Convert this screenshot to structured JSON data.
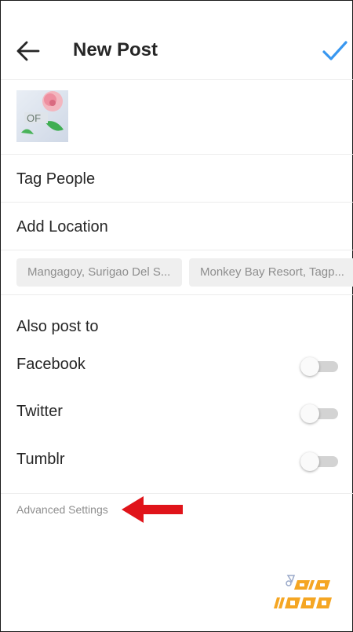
{
  "header": {
    "title": "New Post",
    "back_icon": "arrow-left-icon",
    "confirm_icon": "checkmark-icon",
    "accent_color": "#3897f0"
  },
  "post": {
    "thumbnail_alt": "rose-photo",
    "caption_value": "",
    "caption_placeholder": ""
  },
  "options": {
    "tag_people": "Tag People",
    "add_location": "Add Location"
  },
  "location_suggestions": [
    "Mangagoy, Surigao Del S...",
    "Monkey Bay Resort, Tagp..."
  ],
  "share": {
    "section_title": "Also post to",
    "targets": [
      {
        "label": "Facebook",
        "enabled": false
      },
      {
        "label": "Twitter",
        "enabled": false
      },
      {
        "label": "Tumblr",
        "enabled": false
      }
    ]
  },
  "advanced_settings": "Advanced Settings",
  "annotation": {
    "arrow_color": "#e0141a"
  },
  "watermark": {
    "text": "SIB 1100",
    "color": "#f5a623"
  }
}
